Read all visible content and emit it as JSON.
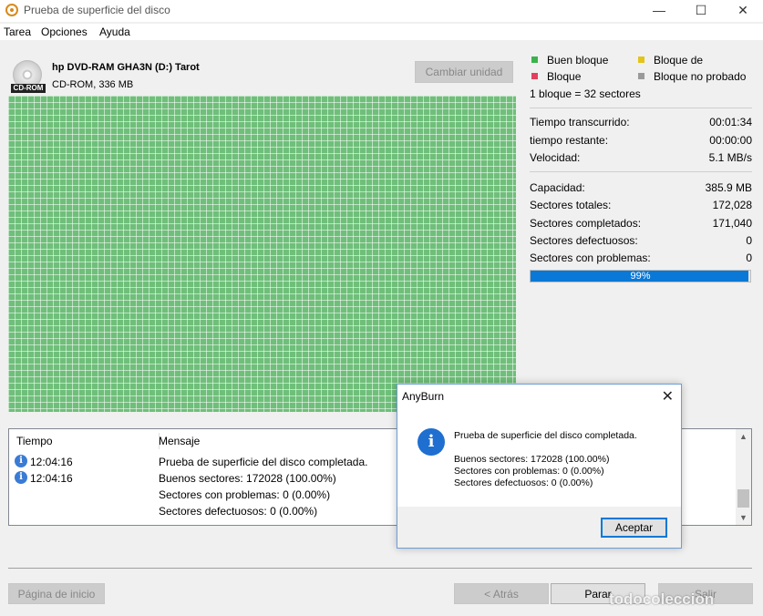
{
  "window": {
    "title": "Prueba de superficie del disco",
    "minimize": "—",
    "maximize": "☐",
    "close": "✕"
  },
  "menu": [
    "Tarea",
    "Opciones",
    "Ayuda"
  ],
  "drive": {
    "badge": "CD-ROM",
    "name": "hp DVD-RAM GHA3N (D:) Tarot",
    "description": "CD-ROM, 336 MB",
    "change_button": "Cambiar unidad"
  },
  "legend": {
    "good": "Buen bloque",
    "bad_delay": "Bloque de",
    "bad": "Bloque",
    "untested": "Bloque no probado",
    "block_info": "1 bloque = 32 sectores",
    "colors": {
      "good": "#3bb34a",
      "delay": "#e3c419",
      "bad": "#e2405f",
      "untested": "#9a9a9a"
    }
  },
  "stats": {
    "elapsed_label": "Tiempo transcurrido:",
    "elapsed": "00:01:34",
    "remaining_label": "tiempo restante:",
    "remaining": "00:00:00",
    "speed_label": "Velocidad:",
    "speed": "5.1 MB/s",
    "capacity_label": "Capacidad:",
    "capacity": "385.9 MB",
    "total_label": "Sectores totales:",
    "total": "172,028",
    "completed_label": "Sectores completados:",
    "completed": "171,040",
    "defective_label": "Sectores defectuosos:",
    "defective": "0",
    "problem_label": "Sectores con problemas:",
    "problem": "0"
  },
  "progress": {
    "text": "99%",
    "value": 0.99
  },
  "log": {
    "col_time": "Tiempo",
    "col_message": "Mensaje",
    "entries": [
      {
        "time": "12:04:16",
        "message": "Prueba de superficie del disco completada."
      },
      {
        "time": "12:04:16",
        "message": "Buenos sectores:    172028 (100.00%)"
      }
    ],
    "continuation": [
      "Sectores con problemas:    0 (0.00%)",
      "Sectores defectuosos:    0 (0.00%)"
    ]
  },
  "buttons": {
    "home": "Página de inicio",
    "back": "< Atrás",
    "stop": "Parar",
    "exit": "Salir"
  },
  "dialog": {
    "title": "AnyBurn",
    "message": "Prueba de superficie del disco completada.",
    "good": "Buenos sectores:   172028 (100.00%)",
    "problem": "Sectores con problemas:   0 (0.00%)",
    "defective": "Sectores defectuosos:   0 (0.00%)",
    "accept": "Aceptar"
  },
  "watermark": "todocoleccion"
}
